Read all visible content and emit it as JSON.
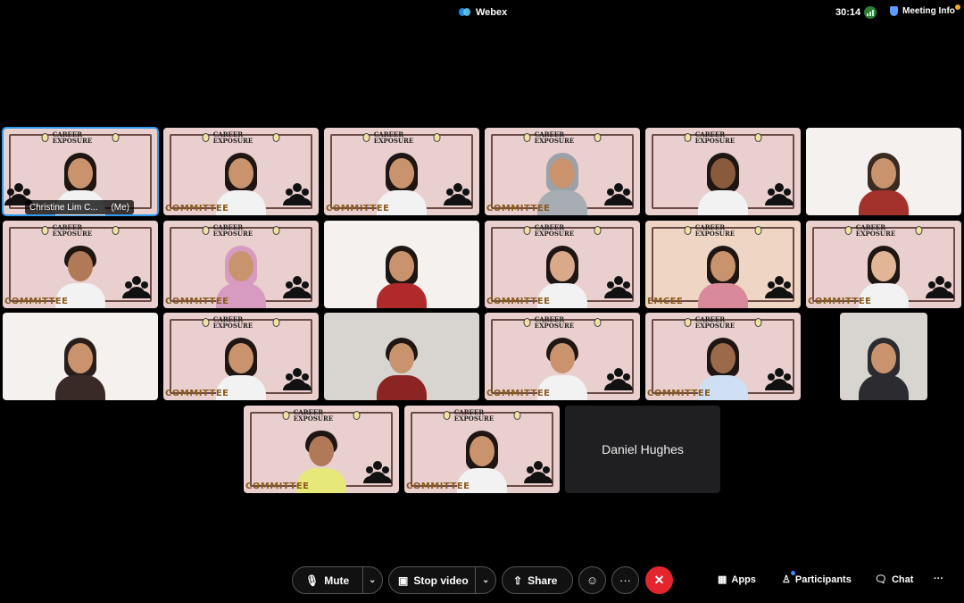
{
  "app": {
    "title": "Webex"
  },
  "status": {
    "timer": "30:14",
    "meeting_info_label": "Meeting Info"
  },
  "self_tile": {
    "name": "Christine Lim C...",
    "me_tag": "(Me)"
  },
  "tile_banner": {
    "brand": "CAREER EXPOSURE",
    "committee": "COMMITTEE",
    "emcee": "EMCEE"
  },
  "named_only_tile": {
    "name": "Daniel Hughes"
  },
  "controls": {
    "mute_label": "Mute",
    "stop_video_label": "Stop video",
    "share_label": "Share",
    "apps_label": "Apps",
    "participants_label": "Participants",
    "chat_label": "Chat"
  },
  "colors": {
    "background": "#000000",
    "tile_pink": "#e9cfcd",
    "selected_outline": "#2f9bf0",
    "leave_red": "#e5252d",
    "accent_blue": "#3d8bff"
  },
  "icons": [
    "webex-logo-icon",
    "network-icon",
    "shield-icon",
    "microphone-icon",
    "chevron-down-icon",
    "video-camera-icon",
    "share-screen-icon",
    "reaction-icon",
    "more-icon",
    "close-icon",
    "apps-icon",
    "participants-icon",
    "chat-icon",
    "overflow-icon",
    "people-group-icon"
  ]
}
